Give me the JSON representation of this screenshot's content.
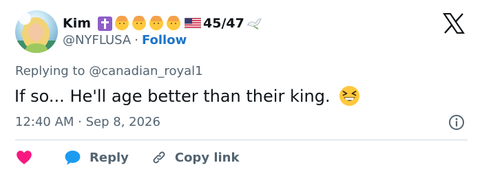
{
  "author": {
    "display_name": "Kim",
    "handle": "@NYFLUSA",
    "separator": "·",
    "follow_label": "Follow",
    "count_text": "45/47",
    "badges": [
      "latin-cross-emoji",
      "baby-face-emoji",
      "baby-face-emoji",
      "baby-face-emoji",
      "baby-face-emoji",
      "us-flag-emoji",
      "dove-emoji"
    ]
  },
  "reply_context": {
    "prefix": "Replying to ",
    "target": "@canadian_royal1"
  },
  "tweet": {
    "text": "If so... He'll age better than their king.",
    "emoji": "grinning-squinting-face-emoji"
  },
  "meta": {
    "timestamp": "12:40 AM · Sep 8, 2026"
  },
  "actions": {
    "reply_label": "Reply",
    "copy_label": "Copy link"
  },
  "colors": {
    "accent": "#1d74c8",
    "secondary_text": "#536471",
    "primary_text": "#0f1419",
    "like": "#f91880",
    "reply": "#1d9bf0",
    "divider": "#cfd9de"
  }
}
